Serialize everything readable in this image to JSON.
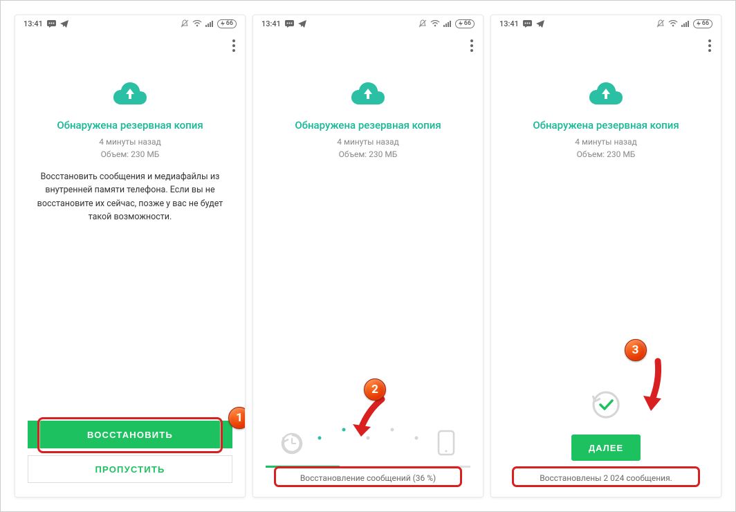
{
  "status_bar": {
    "time": "13:41",
    "battery": "66"
  },
  "common": {
    "title": "Обнаружена резервная копия",
    "when": "4 минуты назад",
    "size": "Объем: 230 МБ"
  },
  "screen1": {
    "desc": "Восстановить сообщения и медиафайлы из внутренней памяти телефона. Если вы не восстановите их сейчас, позже у вас не будет такой возможности.",
    "btn_restore": "ВОССТАНОВИТЬ",
    "btn_skip": "ПРОПУСТИТЬ",
    "badge": "1"
  },
  "screen2": {
    "progress_text": "Восстановление сообщений (36 %)",
    "badge": "2"
  },
  "screen3": {
    "btn_next": "ДАЛЕЕ",
    "done_text": "Восстановлены 2 024 сообщения.",
    "badge": "3"
  }
}
